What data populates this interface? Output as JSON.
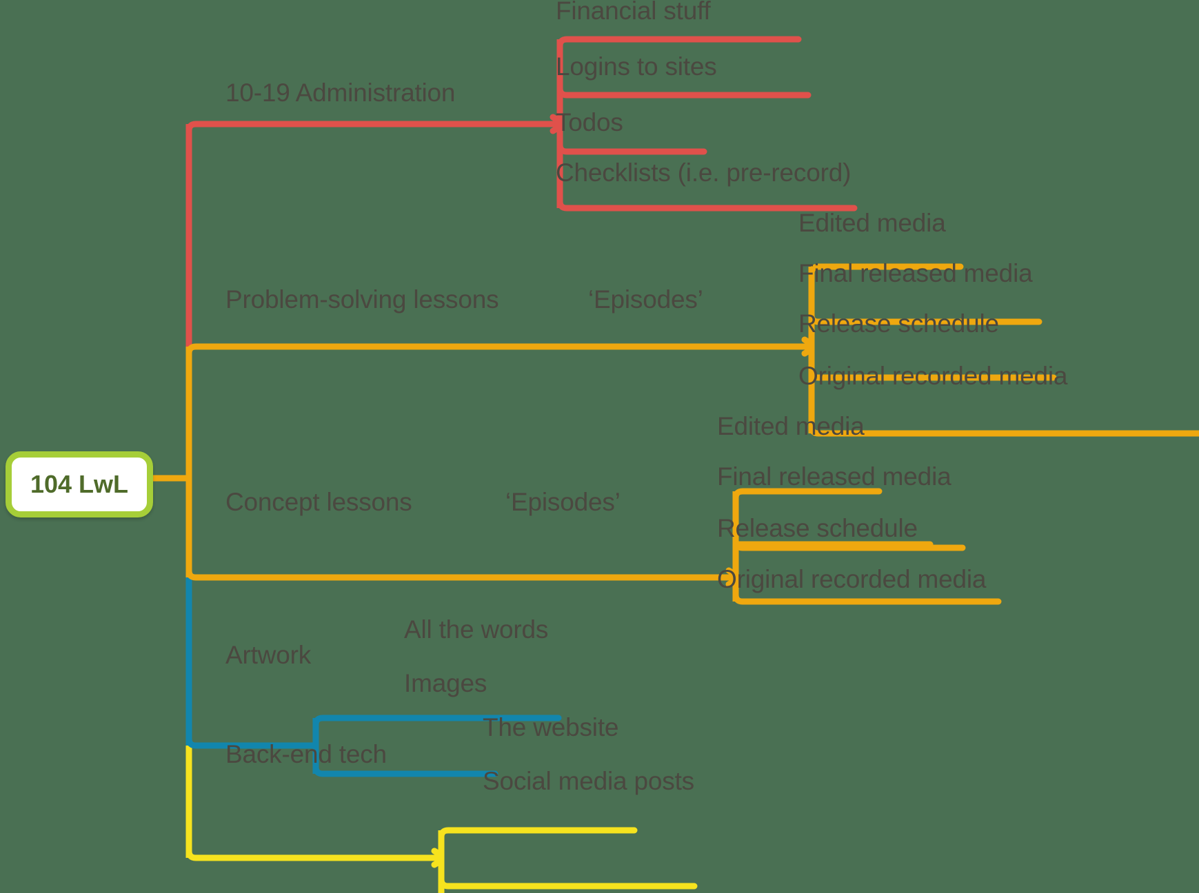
{
  "diagram": {
    "type": "mind-map",
    "orientation": "left-to-right",
    "background_color": "#4a7053",
    "label_color": "#4b4840",
    "root": {
      "label": "104 LwL",
      "text_color": "#4f6b2a",
      "border_color": "#a6ce38",
      "fill_color": "#ffffff"
    },
    "branches": [
      {
        "id": "administration",
        "label": "10-19 Administration",
        "color": "#e0514b",
        "children": [
          {
            "label": "Financial stuff"
          },
          {
            "label": "Logins to sites"
          },
          {
            "label": "Todos"
          },
          {
            "label": "Checklists (i.e. pre-record)"
          }
        ]
      },
      {
        "id": "problem-solving-lessons",
        "label": "Problem-solving lessons",
        "sub_label": "‘Episodes’",
        "color": "#efa80f",
        "children": [
          {
            "label": "Edited media"
          },
          {
            "label": "Final released media"
          },
          {
            "label": "Release schedule"
          },
          {
            "label": "Original recorded media"
          }
        ]
      },
      {
        "id": "concept-lessons",
        "label": "Concept lessons",
        "sub_label": "‘Episodes’",
        "color": "#efa80f",
        "children": [
          {
            "label": "Edited media"
          },
          {
            "label": "Final released media"
          },
          {
            "label": "Release schedule"
          },
          {
            "label": "Original recorded media"
          }
        ]
      },
      {
        "id": "artwork",
        "label": "Artwork",
        "color": "#1286ad",
        "children": [
          {
            "label": "All the words"
          },
          {
            "label": "Images"
          }
        ]
      },
      {
        "id": "back-end-tech",
        "label": "Back-end tech",
        "color": "#f6e31e",
        "children": [
          {
            "label": "The website"
          },
          {
            "label": "Social media posts"
          }
        ]
      }
    ]
  }
}
